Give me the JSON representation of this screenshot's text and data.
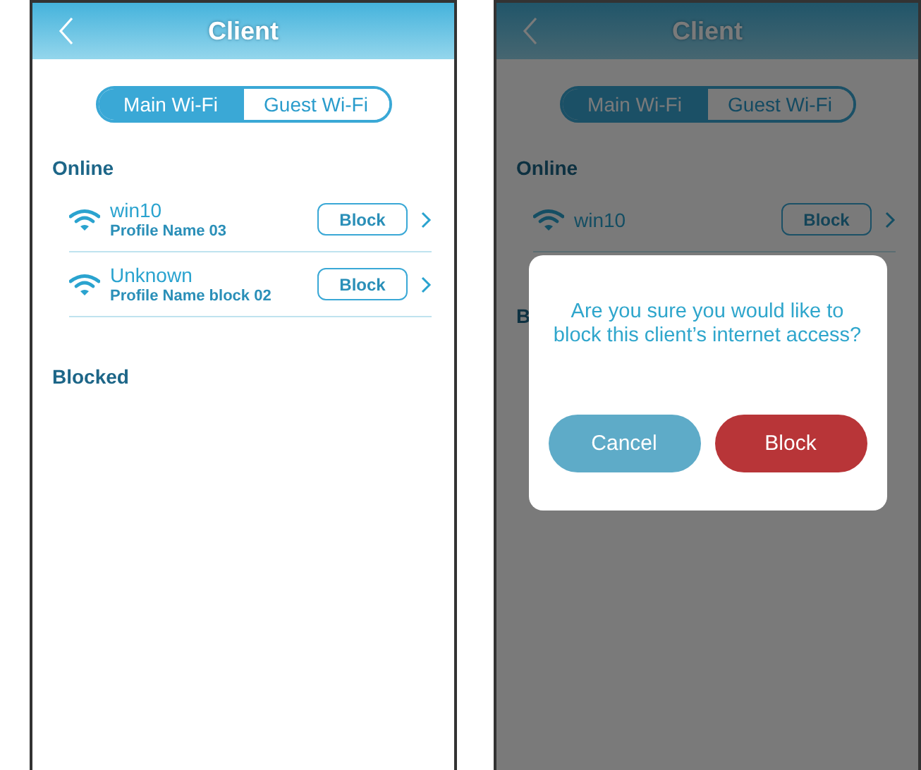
{
  "screens": [
    {
      "title": "Client",
      "tabs": [
        {
          "label": "Main Wi-Fi",
          "selected": true
        },
        {
          "label": "Guest Wi-Fi",
          "selected": false
        }
      ],
      "online_heading": "Online",
      "clients": [
        {
          "name": "win10",
          "profile": "Profile Name 03",
          "action": "Block"
        },
        {
          "name": "Unknown",
          "profile": "Profile Name block 02",
          "action": "Block"
        }
      ],
      "blocked_heading": "Blocked"
    },
    {
      "title": "Client",
      "tabs": [
        {
          "label": "Main Wi-Fi",
          "selected": true
        },
        {
          "label": "Guest Wi-Fi",
          "selected": false
        }
      ],
      "online_heading": "Online",
      "clients": [
        {
          "name": "win10",
          "action": "Block"
        }
      ],
      "blocked_heading": "B",
      "dialog": {
        "message": "Are you sure you would like to block this client’s internet access?",
        "buttons": [
          {
            "label": "Cancel",
            "kind": "cancel"
          },
          {
            "label": "Block",
            "kind": "confirm"
          }
        ]
      }
    }
  ]
}
